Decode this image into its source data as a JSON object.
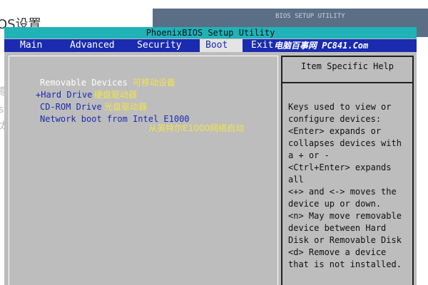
{
  "background": {
    "title": "OS设置",
    "ghost_title": "BIOS SETUP UTILITY",
    "fragments": [
      "意",
      "s",
      "太"
    ]
  },
  "bios": {
    "title": "PhoenixBIOS Setup Utility",
    "tabs": [
      {
        "label": "Main",
        "active": false
      },
      {
        "label": "Advanced",
        "active": false
      },
      {
        "label": "Security",
        "active": false
      },
      {
        "label": "Boot",
        "active": true
      },
      {
        "label": "Exit",
        "active": false
      }
    ],
    "watermark": "电脑百事网 PC841.Com",
    "boot_items": [
      {
        "label": "Removable Devices",
        "note": "可移动设备"
      },
      {
        "label": "+Hard Drive",
        "note": "硬盘驱动器"
      },
      {
        "label": "CD-ROM Drive",
        "note": "光盘驱动器"
      },
      {
        "label": "Network boot from Intel E1000",
        "note": "从英特尔E1000网络启动"
      }
    ],
    "help": {
      "title": "Item Specific Help",
      "lines": [
        "Keys used to view or",
        "configure devices:",
        "<Enter> expands or",
        "collapses devices with",
        "a + or -",
        "<Ctrl+Enter> expands",
        "all",
        "<+> and <-> moves the",
        "device up or down.",
        "<n> May move removable",
        "device between Hard",
        "Disk or Removable Disk",
        "<d> Remove a device",
        "that is not installed."
      ]
    },
    "colors": {
      "title_bar": "#1fb3b8",
      "menu_bar": "#1a2bb0",
      "screen_bg": "#bdbdbd",
      "note_text": "#f2e44a"
    }
  }
}
